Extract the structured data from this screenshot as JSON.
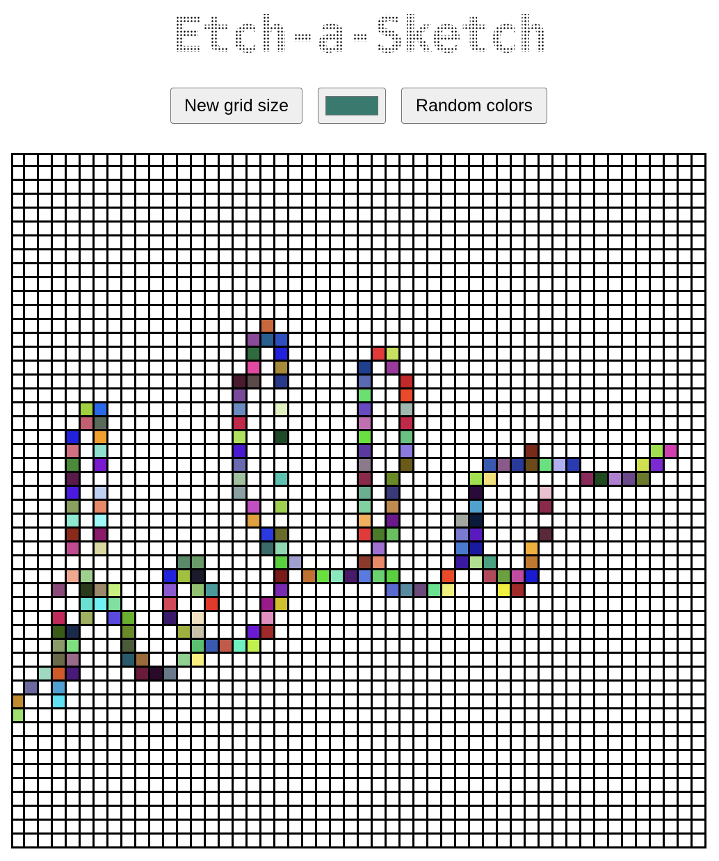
{
  "page": {
    "title": "Etch-a-Sketch"
  },
  "controls": {
    "new_grid_label": "New grid size",
    "color_value": "#3a7a6e",
    "random_colors_label": "Random colors"
  },
  "grid": {
    "size": 50,
    "background": "#ffffff",
    "line_color": "#000000",
    "painted": [
      [
        "r12c18",
        "#c8683e"
      ],
      [
        "r13c17",
        "#8a4a9a"
      ],
      [
        "r13c18",
        "#2a5e8e"
      ],
      [
        "r13c19",
        "#2f4fbf"
      ],
      [
        "r14c17",
        "#2e6b3f"
      ],
      [
        "r14c19",
        "#2222dd"
      ],
      [
        "r14c26",
        "#e03a3a"
      ],
      [
        "r14c27",
        "#c8e060"
      ],
      [
        "r15c17",
        "#e04aa0"
      ],
      [
        "r15c19",
        "#a58a3a"
      ],
      [
        "r15c25",
        "#1f3f8f"
      ],
      [
        "r15c27",
        "#9a3a9a"
      ],
      [
        "r16c16",
        "#4a1a2e"
      ],
      [
        "r16c17",
        "#5a4a4a"
      ],
      [
        "r16c19",
        "#2a3a8a"
      ],
      [
        "r16c25",
        "#5a6ab0"
      ],
      [
        "r16c28",
        "#c02a2a"
      ],
      [
        "r17c16",
        "#7a4a9a"
      ],
      [
        "r17c25",
        "#6ae070"
      ],
      [
        "r17c28",
        "#e84a2a"
      ],
      [
        "r18c5",
        "#a0d040"
      ],
      [
        "r18c6",
        "#2a6ae8"
      ],
      [
        "r18c16",
        "#6a8ac0"
      ],
      [
        "r18c19",
        "#e0f0c0"
      ],
      [
        "r18c25",
        "#6a4ac0"
      ],
      [
        "r18c28",
        "#a0b8b0"
      ],
      [
        "r19c5",
        "#c06070"
      ],
      [
        "r19c6",
        "#5a6a5a"
      ],
      [
        "r19c16",
        "#c02a4a"
      ],
      [
        "r19c25",
        "#c070b0"
      ],
      [
        "r19c28",
        "#c02a4a"
      ],
      [
        "r20c4",
        "#2222dd"
      ],
      [
        "r20c6",
        "#f0a030"
      ],
      [
        "r20c16",
        "#b0e060"
      ],
      [
        "r20c19",
        "#1f4a2a"
      ],
      [
        "r20c25",
        "#6ae040"
      ],
      [
        "r20c28",
        "#6ac080"
      ],
      [
        "r21c4",
        "#d07080"
      ],
      [
        "r21c6",
        "#90e0d0"
      ],
      [
        "r21c16",
        "#4a1ad0"
      ],
      [
        "r21c25",
        "#5a3aa0"
      ],
      [
        "r21c28",
        "#8a7ae0"
      ],
      [
        "r21c37",
        "#7a2a1a"
      ],
      [
        "r21c46",
        "#a0e050"
      ],
      [
        "r21c47",
        "#d040b0"
      ],
      [
        "r22c4",
        "#4a8a3a"
      ],
      [
        "r22c6",
        "#7a1ad0"
      ],
      [
        "r22c16",
        "#6a6ab0"
      ],
      [
        "r22c25",
        "#8a7a8a"
      ],
      [
        "r22c28",
        "#6a5a1a"
      ],
      [
        "r22c34",
        "#3a5ab0"
      ],
      [
        "r22c35",
        "#8a5a8a"
      ],
      [
        "r22c36",
        "#2a3a9a"
      ],
      [
        "r22c37",
        "#6a4a1a"
      ],
      [
        "r22c38",
        "#6ae080"
      ],
      [
        "r22c39",
        "#b0b0f0"
      ],
      [
        "r22c40",
        "#2a3ab0"
      ],
      [
        "r22c45",
        "#d0e050"
      ],
      [
        "r22c46",
        "#7a2ad0"
      ],
      [
        "r23c4",
        "#5a1a4a"
      ],
      [
        "r23c16",
        "#a0c0a0"
      ],
      [
        "r23c19",
        "#60c0b0"
      ],
      [
        "r23c25",
        "#8a2a4a"
      ],
      [
        "r23c27",
        "#6a8a2a"
      ],
      [
        "r23c33",
        "#a0e050"
      ],
      [
        "r23c34",
        "#f0e080"
      ],
      [
        "r23c41",
        "#8a2a5a"
      ],
      [
        "r23c42",
        "#1f4a1f"
      ],
      [
        "r23c43",
        "#b080d0"
      ],
      [
        "r23c44",
        "#6a4a8a"
      ],
      [
        "r23c45",
        "#6a7a2a"
      ],
      [
        "r24c4",
        "#4a1ae0"
      ],
      [
        "r24c6",
        "#c0d0f0"
      ],
      [
        "r24c16",
        "#8aa0a0"
      ],
      [
        "r24c25",
        "#6ab090"
      ],
      [
        "r24c27",
        "#3a3a7a"
      ],
      [
        "r24c33",
        "#2a0a3a"
      ],
      [
        "r24c38",
        "#e8c0d0"
      ],
      [
        "r25c4",
        "#8aa060"
      ],
      [
        "r25c6",
        "#e88a6a"
      ],
      [
        "r25c17",
        "#c050c0"
      ],
      [
        "r25c19",
        "#a0d050"
      ],
      [
        "r25c25",
        "#80d0a0"
      ],
      [
        "r25c27",
        "#c08a50"
      ],
      [
        "r25c33",
        "#50a0d0"
      ],
      [
        "r25c38",
        "#8a2a4a"
      ],
      [
        "r26c4",
        "#90e8d0"
      ],
      [
        "r26c6",
        "#a0f8f8"
      ],
      [
        "r26c17",
        "#e0a040"
      ],
      [
        "r26c25",
        "#f0b060"
      ],
      [
        "r26c27",
        "#6a1a8a"
      ],
      [
        "r26c32",
        "#a0a8a0"
      ],
      [
        "r26c33",
        "#0a1a3a"
      ],
      [
        "r27c4",
        "#8a2a1a"
      ],
      [
        "r27c6",
        "#8a1a6a"
      ],
      [
        "r27c18",
        "#2a3ae0"
      ],
      [
        "r27c19",
        "#6a6a2a"
      ],
      [
        "r27c25",
        "#e03a3a"
      ],
      [
        "r27c26",
        "#4a7a2a"
      ],
      [
        "r27c27",
        "#6ac060"
      ],
      [
        "r27c32",
        "#7a7ad0"
      ],
      [
        "r27c33",
        "#5a1ac0"
      ],
      [
        "r27c38",
        "#5a2a3a"
      ],
      [
        "r28c4",
        "#c04a90"
      ],
      [
        "r28c6",
        "#d8d8a0"
      ],
      [
        "r28c18",
        "#3a6a6a"
      ],
      [
        "r28c19",
        "#90d8b0"
      ],
      [
        "r28c26",
        "#a070d0"
      ],
      [
        "r28c32",
        "#4a7ad0"
      ],
      [
        "r28c33",
        "#1a1aa0"
      ],
      [
        "r28c37",
        "#f0b040"
      ],
      [
        "r29c12",
        "#5a8a6a"
      ],
      [
        "r29c13",
        "#6a9a6a"
      ],
      [
        "r29c19",
        "#5ad040"
      ],
      [
        "r29c20",
        "#a0a0d0"
      ],
      [
        "r29c25",
        "#8a3a2a"
      ],
      [
        "r29c26",
        "#e88a6a"
      ],
      [
        "r29c32",
        "#3a1aa0"
      ],
      [
        "r29c33",
        "#b0e090"
      ],
      [
        "r29c34",
        "#4aa080"
      ],
      [
        "r29c37",
        "#c07a30"
      ],
      [
        "r30c4",
        "#f0a890"
      ],
      [
        "r30c5",
        "#a0d090"
      ],
      [
        "r30c11",
        "#2222dd"
      ],
      [
        "r30c12",
        "#a0c040"
      ],
      [
        "r30c13",
        "#1a1a2a"
      ],
      [
        "r30c19",
        "#7a1a1a"
      ],
      [
        "r30c21",
        "#c07030"
      ],
      [
        "r30c22",
        "#6ae040"
      ],
      [
        "r30c23",
        "#8ae8c0"
      ],
      [
        "r30c24",
        "#4a1a6a"
      ],
      [
        "r30c25",
        "#5a7ae0"
      ],
      [
        "r30c26",
        "#6ad070"
      ],
      [
        "r30c27",
        "#5ad040"
      ],
      [
        "r30c31",
        "#e84a2a"
      ],
      [
        "r30c34",
        "#b04a5a"
      ],
      [
        "r30c35",
        "#6aa040"
      ],
      [
        "r30c36",
        "#c04aa0"
      ],
      [
        "r30c37",
        "#1a1ad0"
      ],
      [
        "r31c3",
        "#8a4a7a"
      ],
      [
        "r31c5",
        "#2a3a1a"
      ],
      [
        "r31c6",
        "#9a8a6a"
      ],
      [
        "r31c7",
        "#c8f080"
      ],
      [
        "r31c11",
        "#8a5ad0"
      ],
      [
        "r31c13",
        "#90c070"
      ],
      [
        "r31c14",
        "#4a9a9a"
      ],
      [
        "r31c19",
        "#7a2ab0"
      ],
      [
        "r31c27",
        "#5a6ad0"
      ],
      [
        "r31c28",
        "#5a8aa0"
      ],
      [
        "r31c29",
        "#6a4a7a"
      ],
      [
        "r31c30",
        "#6ae090"
      ],
      [
        "r31c31",
        "#f0f080"
      ],
      [
        "r31c35",
        "#f0f040"
      ],
      [
        "r31c36",
        "#a02a2a"
      ],
      [
        "r32c5",
        "#6ae0d0"
      ],
      [
        "r32c6",
        "#70f0f0"
      ],
      [
        "r32c7",
        "#80e0a0"
      ],
      [
        "r32c11",
        "#d04a5a"
      ],
      [
        "r32c14",
        "#e03a2a"
      ],
      [
        "r32c18",
        "#9a1a8a"
      ],
      [
        "r32c19",
        "#d0c030"
      ],
      [
        "r33c3",
        "#c02a5a"
      ],
      [
        "r33c5",
        "#a0b060"
      ],
      [
        "r33c7",
        "#5a4ae0"
      ],
      [
        "r33c8",
        "#6ab030"
      ],
      [
        "r33c11",
        "#3a1a6a"
      ],
      [
        "r33c13",
        "#f0e0c0"
      ],
      [
        "r33c18",
        "#e090c0"
      ],
      [
        "r34c3",
        "#3a5a1a"
      ],
      [
        "r34c4",
        "#1a2a4a"
      ],
      [
        "r34c8",
        "#6a8a2a"
      ],
      [
        "r34c12",
        "#a0b040"
      ],
      [
        "r34c13",
        "#c8c0a8"
      ],
      [
        "r34c17",
        "#6a1ad0"
      ],
      [
        "r34c18",
        "#a02a2a"
      ],
      [
        "r35c3",
        "#8a9a6a"
      ],
      [
        "r35c4",
        "#80e080"
      ],
      [
        "r35c8",
        "#4a5a3a"
      ],
      [
        "r35c13",
        "#5ac070"
      ],
      [
        "r35c14",
        "#3a5ab0"
      ],
      [
        "r35c15",
        "#c05a4a"
      ],
      [
        "r35c16",
        "#70f0c0"
      ],
      [
        "r35c17",
        "#c0f050"
      ],
      [
        "r36c3",
        "#6a6a4a"
      ],
      [
        "r36c4",
        "#9a6a8a"
      ],
      [
        "r36c8",
        "#2a5a6a"
      ],
      [
        "r36c9",
        "#9a6a3a"
      ],
      [
        "r36c12",
        "#90d090"
      ],
      [
        "r36c13",
        "#f8f080"
      ],
      [
        "r37c2",
        "#a0d8c0"
      ],
      [
        "r37c3",
        "#d05a2a"
      ],
      [
        "r37c4",
        "#4a1a7a"
      ],
      [
        "r37c9",
        "#6a1a3a"
      ],
      [
        "r37c10",
        "#2a0a2a"
      ],
      [
        "r37c11",
        "#6a7a8a"
      ],
      [
        "r38c1",
        "#6a6aa0"
      ],
      [
        "r38c3",
        "#50a0d0"
      ],
      [
        "r39c0",
        "#c08a30"
      ],
      [
        "r39c3",
        "#60e0f0"
      ],
      [
        "r40c0",
        "#a0e070"
      ]
    ]
  }
}
